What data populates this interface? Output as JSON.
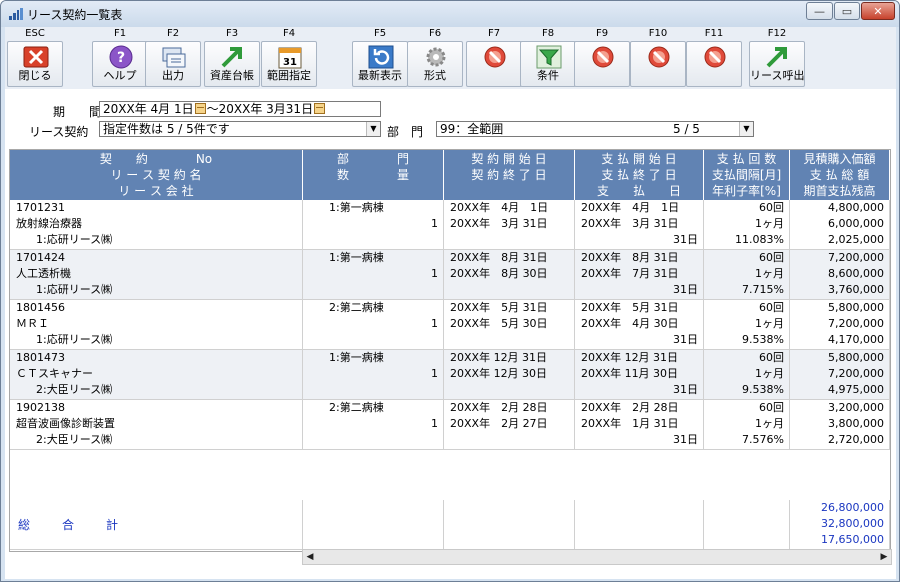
{
  "window": {
    "title": "リース契約一覧表"
  },
  "toolbar": [
    {
      "key": "ESC",
      "label": "閉じる",
      "icon": "close-x-icon"
    },
    {
      "key": "F1",
      "label": "ヘルプ",
      "icon": "help-icon"
    },
    {
      "key": "F2",
      "label": "出力",
      "icon": "output-icon"
    },
    {
      "key": "F3",
      "label": "資産台帳",
      "icon": "arrow-icon"
    },
    {
      "key": "F4",
      "label": "範囲指定",
      "icon": "calendar-icon"
    },
    {
      "key": "F5",
      "label": "最新表示",
      "icon": "refresh-icon"
    },
    {
      "key": "F6",
      "label": "形式",
      "icon": "gear-icon"
    },
    {
      "key": "F7",
      "label": "",
      "icon": "disabled-icon"
    },
    {
      "key": "F8",
      "label": "条件",
      "icon": "filter-icon"
    },
    {
      "key": "F9",
      "label": "",
      "icon": "disabled-icon"
    },
    {
      "key": "F10",
      "label": "",
      "icon": "disabled-icon"
    },
    {
      "key": "F11",
      "label": "",
      "icon": "disabled-icon"
    },
    {
      "key": "F12",
      "label": "リース呼出",
      "icon": "arrow-icon"
    }
  ],
  "filters": {
    "period_label": "期　　間",
    "period_from": "20XX年 4月 1日",
    "period_sep": "～",
    "period_to": "20XX年 3月31日",
    "contract_label": "リース契約",
    "contract_value": "指定件数は 5 / 5件です",
    "dept_label": "部　門",
    "dept_value": "99：全範囲",
    "dept_count": "5 / 5"
  },
  "headers": {
    "col1": [
      "契　　約　　　　No",
      "リ ー ス 契 約 名",
      "リ ー ス 会 社"
    ],
    "col2": [
      "部　　　　門",
      "数　　　　量"
    ],
    "col3": [
      "契 約 開 始 日",
      "契 約 終 了 日"
    ],
    "col4": [
      "支 払 開 始 日",
      "支 払 終 了 日",
      "支　　払　　日"
    ],
    "col5": [
      "支 払 回 数",
      "支払間隔[月]",
      "年利子率[%]"
    ],
    "col6": [
      "見積購入価額",
      "支 払 総 額",
      "期首支払残高"
    ]
  },
  "rows": [
    {
      "no": "1701231",
      "name": "放射線治療器",
      "company": "1:応研リース㈱",
      "dept": "1:第一病棟",
      "qty": "1",
      "cstart": "20XX年　4月　1日",
      "cend": "20XX年　3月 31日",
      "pstart": "20XX年　4月　1日",
      "pend": "20XX年　3月 31日",
      "pday": "31日",
      "count": "60回",
      "interval": "1ヶ月",
      "rate": "11.083%",
      "v1": "4,800,000",
      "v2": "6,000,000",
      "v3": "2,025,000"
    },
    {
      "no": "1701424",
      "name": "人工透析機",
      "company": "1:応研リース㈱",
      "dept": "1:第一病棟",
      "qty": "1",
      "cstart": "20XX年　8月 31日",
      "cend": "20XX年　8月 30日",
      "pstart": "20XX年　8月 31日",
      "pend": "20XX年　7月 31日",
      "pday": "31日",
      "count": "60回",
      "interval": "1ヶ月",
      "rate": "7.715%",
      "v1": "7,200,000",
      "v2": "8,600,000",
      "v3": "3,760,000"
    },
    {
      "no": "1801456",
      "name": "ＭＲＩ",
      "company": "1:応研リース㈱",
      "dept": "2:第二病棟",
      "qty": "1",
      "cstart": "20XX年　5月 31日",
      "cend": "20XX年　5月 30日",
      "pstart": "20XX年　5月 31日",
      "pend": "20XX年　4月 30日",
      "pday": "31日",
      "count": "60回",
      "interval": "1ヶ月",
      "rate": "9.538%",
      "v1": "5,800,000",
      "v2": "7,200,000",
      "v3": "4,170,000"
    },
    {
      "no": "1801473",
      "name": "ＣＴスキャナー",
      "company": "2:大臣リース㈱",
      "dept": "1:第一病棟",
      "qty": "1",
      "cstart": "20XX年 12月 31日",
      "cend": "20XX年 12月 30日",
      "pstart": "20XX年 12月 31日",
      "pend": "20XX年 11月 30日",
      "pday": "31日",
      "count": "60回",
      "interval": "1ヶ月",
      "rate": "9.538%",
      "v1": "5,800,000",
      "v2": "7,200,000",
      "v3": "4,975,000"
    },
    {
      "no": "1902138",
      "name": "超音波画像診断装置",
      "company": "2:大臣リース㈱",
      "dept": "2:第二病棟",
      "qty": "1",
      "cstart": "20XX年　2月 28日",
      "cend": "20XX年　2月 27日",
      "pstart": "20XX年　2月 28日",
      "pend": "20XX年　1月 31日",
      "pday": "31日",
      "count": "60回",
      "interval": "1ヶ月",
      "rate": "7.576%",
      "v1": "3,200,000",
      "v2": "3,800,000",
      "v3": "2,720,000"
    }
  ],
  "totals": {
    "label": "総合計",
    "v1": "26,800,000",
    "v2": "32,800,000",
    "v3": "17,650,000"
  }
}
